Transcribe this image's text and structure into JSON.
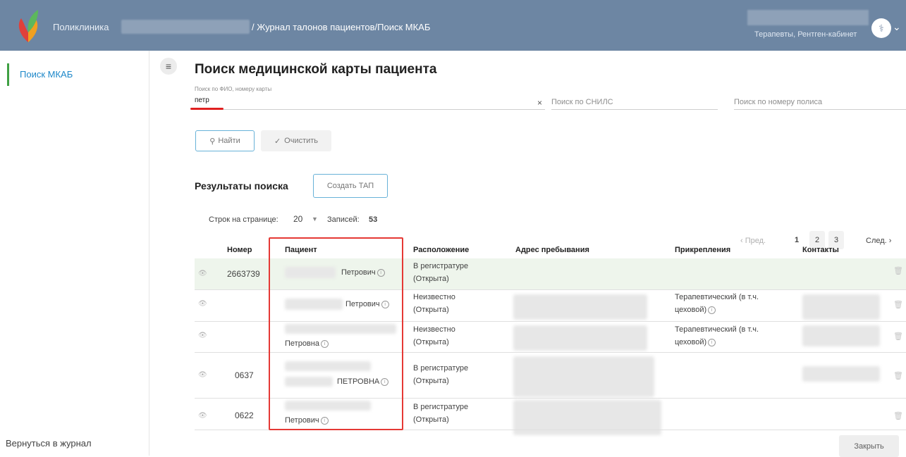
{
  "header": {
    "app_name": "Поликлиника",
    "breadcrumb": "/ Журнал талонов пациентов/Поиск МКАБ",
    "user_role": "Терапевты, Рентген-кабинет"
  },
  "sidebar": {
    "items": [
      {
        "label": "Поиск МКАБ",
        "active": true
      }
    ],
    "bottom_link": "Вернуться в журнал"
  },
  "page": {
    "title": "Поиск медицинской карты пациента",
    "search_fio": {
      "label": "Поиск по ФИО, номеру карты",
      "value": "петр"
    },
    "search_snils": {
      "placeholder": "Поиск по СНИЛС"
    },
    "search_policy": {
      "placeholder": "Поиск по номеру полиса"
    },
    "find_button": "Найти",
    "clear_button": "Очистить"
  },
  "results": {
    "title": "Результаты поиска",
    "create_tap_button": "Создать ТАП",
    "rows_per_page_label": "Строк на странице:",
    "rows_per_page_value": "20",
    "records_label": "Записей:",
    "records_value": "53",
    "pager": {
      "prev": "‹ Пред.",
      "pages": [
        "1",
        "2",
        "3"
      ],
      "current": "1",
      "next": "След. ›"
    },
    "columns": [
      "Номер",
      "Пациент",
      "Расположение",
      "Адрес пребывания",
      "Прикрепления",
      "Контакты"
    ],
    "rows": [
      {
        "number": "2663739",
        "patient": "Петрович",
        "location_1": "В регистратуре",
        "location_2": "(Открыта)",
        "attach_1": "",
        "attach_2": ""
      },
      {
        "number": "",
        "patient": "Петрович",
        "location_1": "Неизвестно",
        "location_2": "(Открыта)",
        "attach_1": "Терапевтический (в т.ч.",
        "attach_2": "цеховой)"
      },
      {
        "number": "",
        "patient": "Петровна",
        "location_1": "Неизвестно",
        "location_2": "(Открыта)",
        "attach_1": "Терапевтический (в т.ч.",
        "attach_2": "цеховой)"
      },
      {
        "number": "0637",
        "patient": "ПЕТРОВНА",
        "location_1": "В регистратуре",
        "location_2": "(Открыта)",
        "attach_1": "",
        "attach_2": ""
      },
      {
        "number": "0622",
        "patient": "Петрович",
        "location_1": "В регистратуре",
        "location_2": "(Открыта)",
        "attach_1": "",
        "attach_2": ""
      }
    ]
  },
  "footer": {
    "close_button": "Закрыть"
  },
  "colors": {
    "header_bg": "#6d86a3",
    "accent": "#1e88c9",
    "active_marker": "#3fa043",
    "highlight": "#e53935"
  }
}
